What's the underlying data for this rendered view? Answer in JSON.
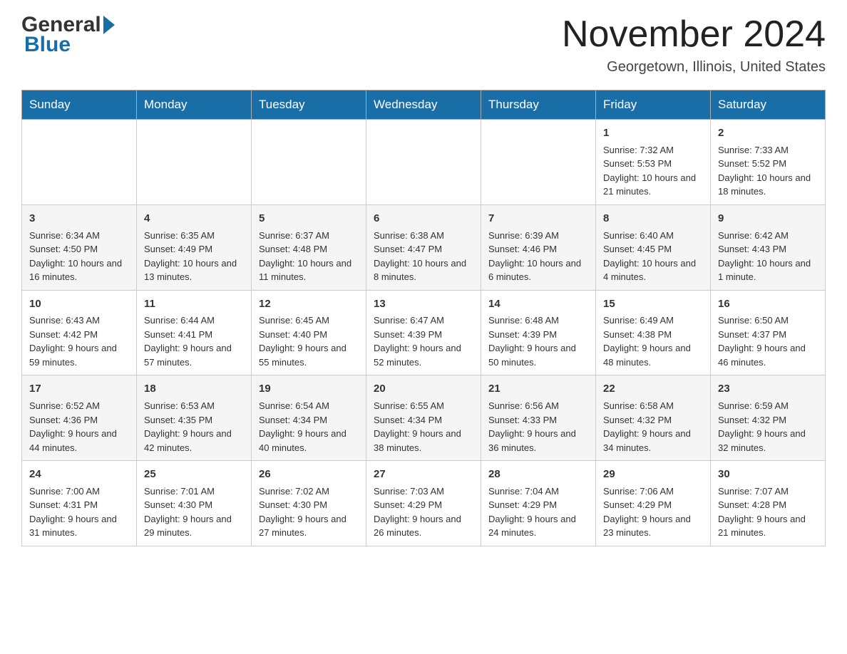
{
  "header": {
    "month_title": "November 2024",
    "location": "Georgetown, Illinois, United States",
    "logo_general": "General",
    "logo_blue": "Blue"
  },
  "days_of_week": [
    "Sunday",
    "Monday",
    "Tuesday",
    "Wednesday",
    "Thursday",
    "Friday",
    "Saturday"
  ],
  "weeks": [
    [
      {
        "day": "",
        "sunrise": "",
        "sunset": "",
        "daylight": ""
      },
      {
        "day": "",
        "sunrise": "",
        "sunset": "",
        "daylight": ""
      },
      {
        "day": "",
        "sunrise": "",
        "sunset": "",
        "daylight": ""
      },
      {
        "day": "",
        "sunrise": "",
        "sunset": "",
        "daylight": ""
      },
      {
        "day": "",
        "sunrise": "",
        "sunset": "",
        "daylight": ""
      },
      {
        "day": "1",
        "sunrise": "Sunrise: 7:32 AM",
        "sunset": "Sunset: 5:53 PM",
        "daylight": "Daylight: 10 hours and 21 minutes."
      },
      {
        "day": "2",
        "sunrise": "Sunrise: 7:33 AM",
        "sunset": "Sunset: 5:52 PM",
        "daylight": "Daylight: 10 hours and 18 minutes."
      }
    ],
    [
      {
        "day": "3",
        "sunrise": "Sunrise: 6:34 AM",
        "sunset": "Sunset: 4:50 PM",
        "daylight": "Daylight: 10 hours and 16 minutes."
      },
      {
        "day": "4",
        "sunrise": "Sunrise: 6:35 AM",
        "sunset": "Sunset: 4:49 PM",
        "daylight": "Daylight: 10 hours and 13 minutes."
      },
      {
        "day": "5",
        "sunrise": "Sunrise: 6:37 AM",
        "sunset": "Sunset: 4:48 PM",
        "daylight": "Daylight: 10 hours and 11 minutes."
      },
      {
        "day": "6",
        "sunrise": "Sunrise: 6:38 AM",
        "sunset": "Sunset: 4:47 PM",
        "daylight": "Daylight: 10 hours and 8 minutes."
      },
      {
        "day": "7",
        "sunrise": "Sunrise: 6:39 AM",
        "sunset": "Sunset: 4:46 PM",
        "daylight": "Daylight: 10 hours and 6 minutes."
      },
      {
        "day": "8",
        "sunrise": "Sunrise: 6:40 AM",
        "sunset": "Sunset: 4:45 PM",
        "daylight": "Daylight: 10 hours and 4 minutes."
      },
      {
        "day": "9",
        "sunrise": "Sunrise: 6:42 AM",
        "sunset": "Sunset: 4:43 PM",
        "daylight": "Daylight: 10 hours and 1 minute."
      }
    ],
    [
      {
        "day": "10",
        "sunrise": "Sunrise: 6:43 AM",
        "sunset": "Sunset: 4:42 PM",
        "daylight": "Daylight: 9 hours and 59 minutes."
      },
      {
        "day": "11",
        "sunrise": "Sunrise: 6:44 AM",
        "sunset": "Sunset: 4:41 PM",
        "daylight": "Daylight: 9 hours and 57 minutes."
      },
      {
        "day": "12",
        "sunrise": "Sunrise: 6:45 AM",
        "sunset": "Sunset: 4:40 PM",
        "daylight": "Daylight: 9 hours and 55 minutes."
      },
      {
        "day": "13",
        "sunrise": "Sunrise: 6:47 AM",
        "sunset": "Sunset: 4:39 PM",
        "daylight": "Daylight: 9 hours and 52 minutes."
      },
      {
        "day": "14",
        "sunrise": "Sunrise: 6:48 AM",
        "sunset": "Sunset: 4:39 PM",
        "daylight": "Daylight: 9 hours and 50 minutes."
      },
      {
        "day": "15",
        "sunrise": "Sunrise: 6:49 AM",
        "sunset": "Sunset: 4:38 PM",
        "daylight": "Daylight: 9 hours and 48 minutes."
      },
      {
        "day": "16",
        "sunrise": "Sunrise: 6:50 AM",
        "sunset": "Sunset: 4:37 PM",
        "daylight": "Daylight: 9 hours and 46 minutes."
      }
    ],
    [
      {
        "day": "17",
        "sunrise": "Sunrise: 6:52 AM",
        "sunset": "Sunset: 4:36 PM",
        "daylight": "Daylight: 9 hours and 44 minutes."
      },
      {
        "day": "18",
        "sunrise": "Sunrise: 6:53 AM",
        "sunset": "Sunset: 4:35 PM",
        "daylight": "Daylight: 9 hours and 42 minutes."
      },
      {
        "day": "19",
        "sunrise": "Sunrise: 6:54 AM",
        "sunset": "Sunset: 4:34 PM",
        "daylight": "Daylight: 9 hours and 40 minutes."
      },
      {
        "day": "20",
        "sunrise": "Sunrise: 6:55 AM",
        "sunset": "Sunset: 4:34 PM",
        "daylight": "Daylight: 9 hours and 38 minutes."
      },
      {
        "day": "21",
        "sunrise": "Sunrise: 6:56 AM",
        "sunset": "Sunset: 4:33 PM",
        "daylight": "Daylight: 9 hours and 36 minutes."
      },
      {
        "day": "22",
        "sunrise": "Sunrise: 6:58 AM",
        "sunset": "Sunset: 4:32 PM",
        "daylight": "Daylight: 9 hours and 34 minutes."
      },
      {
        "day": "23",
        "sunrise": "Sunrise: 6:59 AM",
        "sunset": "Sunset: 4:32 PM",
        "daylight": "Daylight: 9 hours and 32 minutes."
      }
    ],
    [
      {
        "day": "24",
        "sunrise": "Sunrise: 7:00 AM",
        "sunset": "Sunset: 4:31 PM",
        "daylight": "Daylight: 9 hours and 31 minutes."
      },
      {
        "day": "25",
        "sunrise": "Sunrise: 7:01 AM",
        "sunset": "Sunset: 4:30 PM",
        "daylight": "Daylight: 9 hours and 29 minutes."
      },
      {
        "day": "26",
        "sunrise": "Sunrise: 7:02 AM",
        "sunset": "Sunset: 4:30 PM",
        "daylight": "Daylight: 9 hours and 27 minutes."
      },
      {
        "day": "27",
        "sunrise": "Sunrise: 7:03 AM",
        "sunset": "Sunset: 4:29 PM",
        "daylight": "Daylight: 9 hours and 26 minutes."
      },
      {
        "day": "28",
        "sunrise": "Sunrise: 7:04 AM",
        "sunset": "Sunset: 4:29 PM",
        "daylight": "Daylight: 9 hours and 24 minutes."
      },
      {
        "day": "29",
        "sunrise": "Sunrise: 7:06 AM",
        "sunset": "Sunset: 4:29 PM",
        "daylight": "Daylight: 9 hours and 23 minutes."
      },
      {
        "day": "30",
        "sunrise": "Sunrise: 7:07 AM",
        "sunset": "Sunset: 4:28 PM",
        "daylight": "Daylight: 9 hours and 21 minutes."
      }
    ]
  ],
  "colors": {
    "header_bg": "#1a6ea8",
    "header_text": "#ffffff",
    "border": "#aaaaaa",
    "logo_blue": "#1a6ea8"
  }
}
